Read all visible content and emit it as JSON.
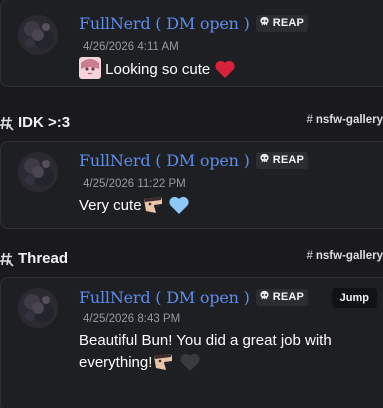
{
  "results": [
    {
      "author": "FullNerd ( DM open )",
      "tag": "REAP",
      "timestamp": "4/26/2026 4:11 AM",
      "content": "Looking so cute"
    },
    {
      "thread": {
        "name": "IDK >:3",
        "channel": "nsfw-gallery"
      },
      "author": "FullNerd ( DM open )",
      "tag": "REAP",
      "timestamp": "4/25/2026 11:22 PM",
      "content": "Very cute"
    },
    {
      "thread": {
        "name": "Thread",
        "channel": "nsfw-gallery"
      },
      "author": "FullNerd ( DM open )",
      "tag": "REAP",
      "timestamp": "4/25/2026 8:43 PM",
      "content_line1": "Beautiful Bun! You did a great job with",
      "content_line2": "everything!",
      "jump_label": "Jump"
    }
  ],
  "colors": {
    "author": "#5b8dee",
    "heart_red": "#d6233b",
    "heart_blue": "#8ec8f6",
    "heart_black": "#3a3b3e"
  },
  "icons": [
    "skull-icon",
    "thread-icon",
    "hash-icon",
    "anime-sticker-emoji",
    "red-heart-emoji",
    "blue-heart-emoji",
    "black-heart-emoji",
    "face-emoji"
  ]
}
